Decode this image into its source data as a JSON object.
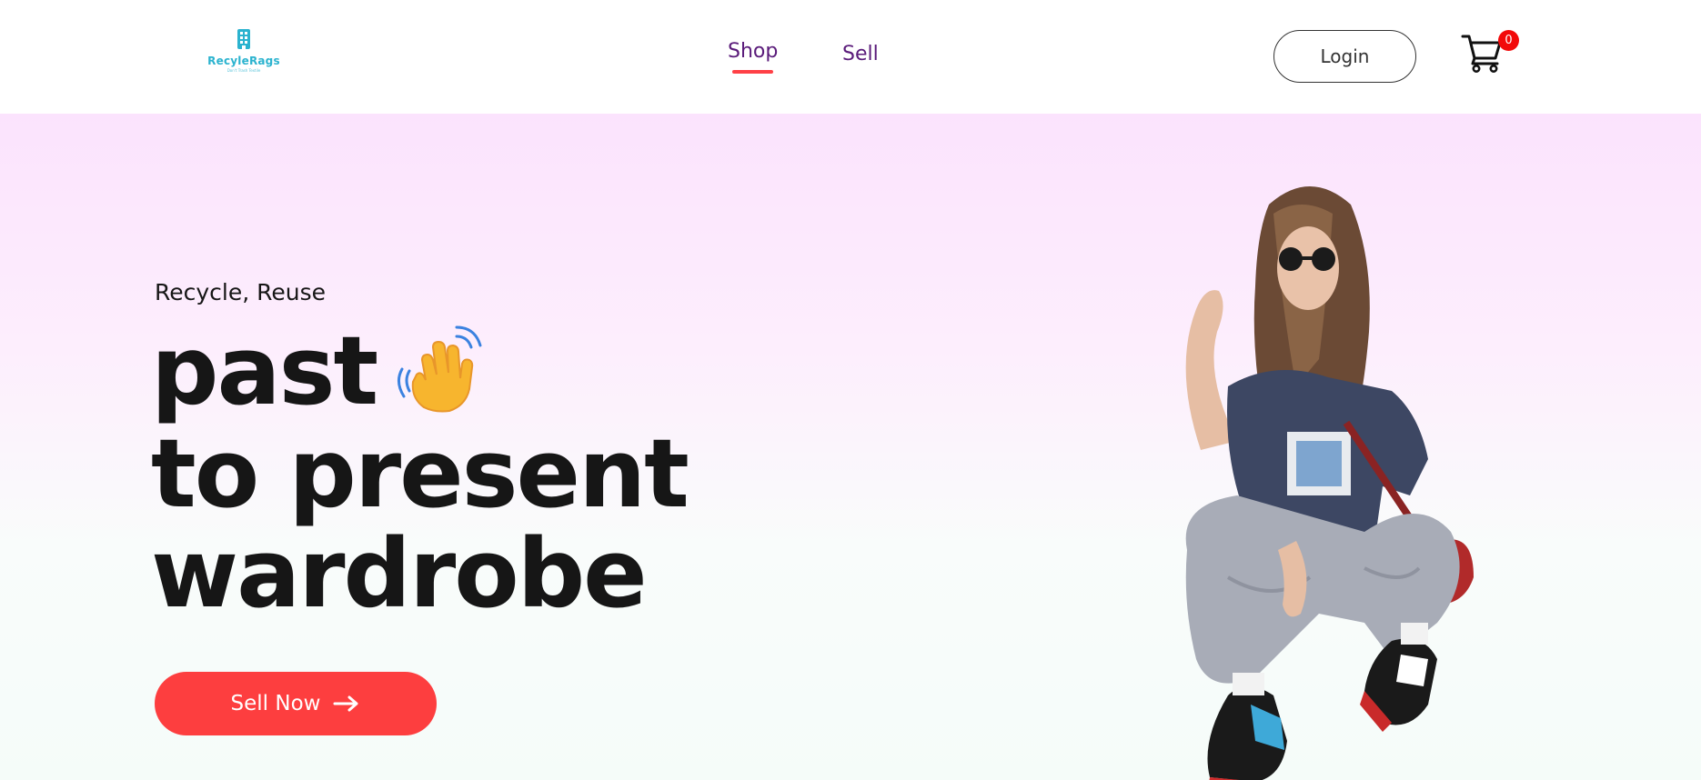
{
  "header": {
    "logo": {
      "name": "RecyleRags",
      "tagline": "Don't Trash Textile"
    },
    "nav": [
      {
        "label": "Shop",
        "active": true
      },
      {
        "label": "Sell",
        "active": false
      }
    ],
    "login_label": "Login",
    "cart": {
      "count": "0"
    }
  },
  "hero": {
    "eyebrow": "Recycle, Reuse",
    "headline_lines": [
      "past",
      "to present",
      "wardrobe"
    ],
    "cta_label": "Sell Now"
  },
  "icons": {
    "logo": "building-icon",
    "cart": "cart-icon",
    "wave": "waving-hand-icon",
    "cta": "arrow-right-icon"
  },
  "colors": {
    "brand": "#2bb3cf",
    "nav_text": "#5a1b7a",
    "accent": "#fd3e3f",
    "badge": "#f20a0a",
    "hero_top": "#fbe3fd",
    "hero_bottom": "#f5fcf9"
  }
}
